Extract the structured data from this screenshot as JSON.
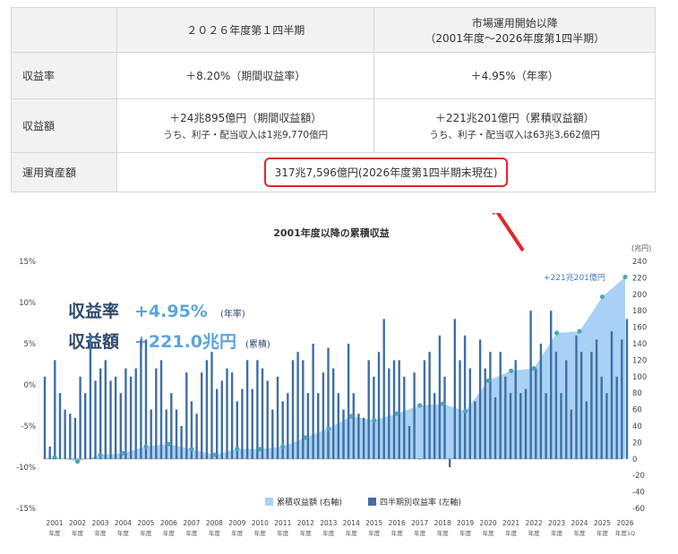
{
  "summary_table": {
    "col1_header": "２０２６年度第１四半期",
    "col2_header_line1": "市場運用開始以降",
    "col2_header_line2": "（2001年度～2026年度第1四半期）",
    "rows": [
      {
        "label": "収益率",
        "col1": "＋8.20%（期間収益率）",
        "col2": "＋4.95%（年率）",
        "col1_sub": "",
        "col2_sub": ""
      },
      {
        "label": "収益額",
        "col1": "＋24兆895億円（期間収益額）",
        "col1_sub": "うち、利子・配当収入は1兆9,770億円",
        "col2": "＋221兆201億円（累積収益額）",
        "col2_sub": "うち、利子・配当収入は63兆3,662億円"
      },
      {
        "label": "運用資産額",
        "merged": "317兆7,596億円(2026年度第1四半期末現在)"
      }
    ]
  },
  "colors": {
    "area": "#a9d1f5",
    "bar": "#3f6fa3",
    "dot": "#4aa8b0",
    "highlight": "#e3262a",
    "headline_dark": "#2d4b6e",
    "headline_accent": "#5aa5dc"
  },
  "headline": {
    "line1_label": "収益率",
    "line1_value": "+4.95%",
    "line1_unit": "(年率)",
    "line2_label": "収益額",
    "line2_value": "+221.0兆円",
    "line2_unit": "(累積)"
  },
  "chart_data": {
    "type": "bar",
    "title": "2001年度以降の累積収益",
    "right_axis_unit": "(兆円)",
    "right_ylim": [
      -60,
      240
    ],
    "right_ticks": [
      240,
      220,
      200,
      180,
      160,
      140,
      120,
      100,
      80,
      60,
      40,
      20,
      0,
      -20,
      -40,
      -60
    ],
    "left_ylim": [
      -15,
      15
    ],
    "left_ticks": [
      "15%",
      "10%",
      "5%",
      "0%",
      "-5%",
      "-10%",
      "-15%"
    ],
    "left_tick_values": [
      15,
      10,
      5,
      0,
      -5,
      -10,
      -15
    ],
    "year_labels": [
      "2001",
      "2002",
      "2003",
      "2004",
      "2005",
      "2006",
      "2007",
      "2008",
      "2009",
      "2010",
      "2011",
      "2012",
      "2013",
      "2014",
      "2015",
      "2016",
      "2017",
      "2018",
      "2019",
      "2020",
      "2021",
      "2022",
      "2023",
      "2024",
      "2025",
      "2026"
    ],
    "year_sublabel": "年度",
    "last_sublabel": "年度1Q",
    "annotation": "+221兆201億円",
    "legend": [
      {
        "label": "累積収益額 (右軸)",
        "kind": "area"
      },
      {
        "label": "四半期別収益率 (左軸)",
        "kind": "bar"
      }
    ],
    "legend_position": "bottom-right",
    "cumulative_series": {
      "name": "累積収益額 (右軸)",
      "x": [
        2001,
        2002,
        2003,
        2004,
        2005,
        2006,
        2007,
        2008,
        2009,
        2010,
        2011,
        2012,
        2013,
        2014,
        2015,
        2016,
        2017,
        2018,
        2019,
        2020,
        2021,
        2022,
        2023,
        2024,
        2025,
        2026
      ],
      "values": [
        2,
        -3,
        5,
        7,
        15,
        18,
        12,
        5,
        12,
        12,
        15,
        26,
        37,
        52,
        47,
        55,
        65,
        67,
        58,
        95,
        107,
        110,
        153,
        155,
        197,
        221
      ]
    },
    "quarterly_series": {
      "name": "四半期別収益率 (左軸)",
      "values": [
        1,
        -7.5,
        3,
        -1,
        -3,
        -3.5,
        -4,
        1,
        -1,
        6,
        0.5,
        2,
        3,
        0.5,
        1,
        -1,
        2,
        1,
        2,
        5.5,
        5.5,
        -3,
        2,
        3,
        -3,
        -1,
        -3,
        -5,
        1.5,
        -2,
        -3.5,
        1.5,
        3,
        4,
        -0.5,
        0.5,
        2,
        1.5,
        -2,
        -0.5,
        3,
        -0.5,
        3,
        2,
        0.5,
        -3,
        1,
        -2,
        -1,
        3,
        4,
        3,
        -1,
        5,
        -1,
        1.5,
        4.5,
        2,
        -1,
        -3,
        5,
        -1,
        -3.5,
        -4,
        3,
        1,
        4,
        8,
        2,
        3,
        3,
        1,
        -5,
        1.5,
        -9,
        3,
        4,
        -1,
        6,
        1,
        -10,
        8,
        3,
        6,
        2,
        -2,
        5.5,
        2,
        4,
        -1.5,
        4,
        1,
        -1,
        3,
        -1,
        -0.5,
        9,
        2,
        5,
        -1,
        9,
        4,
        -1,
        3,
        -3,
        6,
        4,
        -2,
        4,
        5.5,
        1,
        -1,
        6.5,
        1,
        5.5,
        8
      ]
    }
  }
}
